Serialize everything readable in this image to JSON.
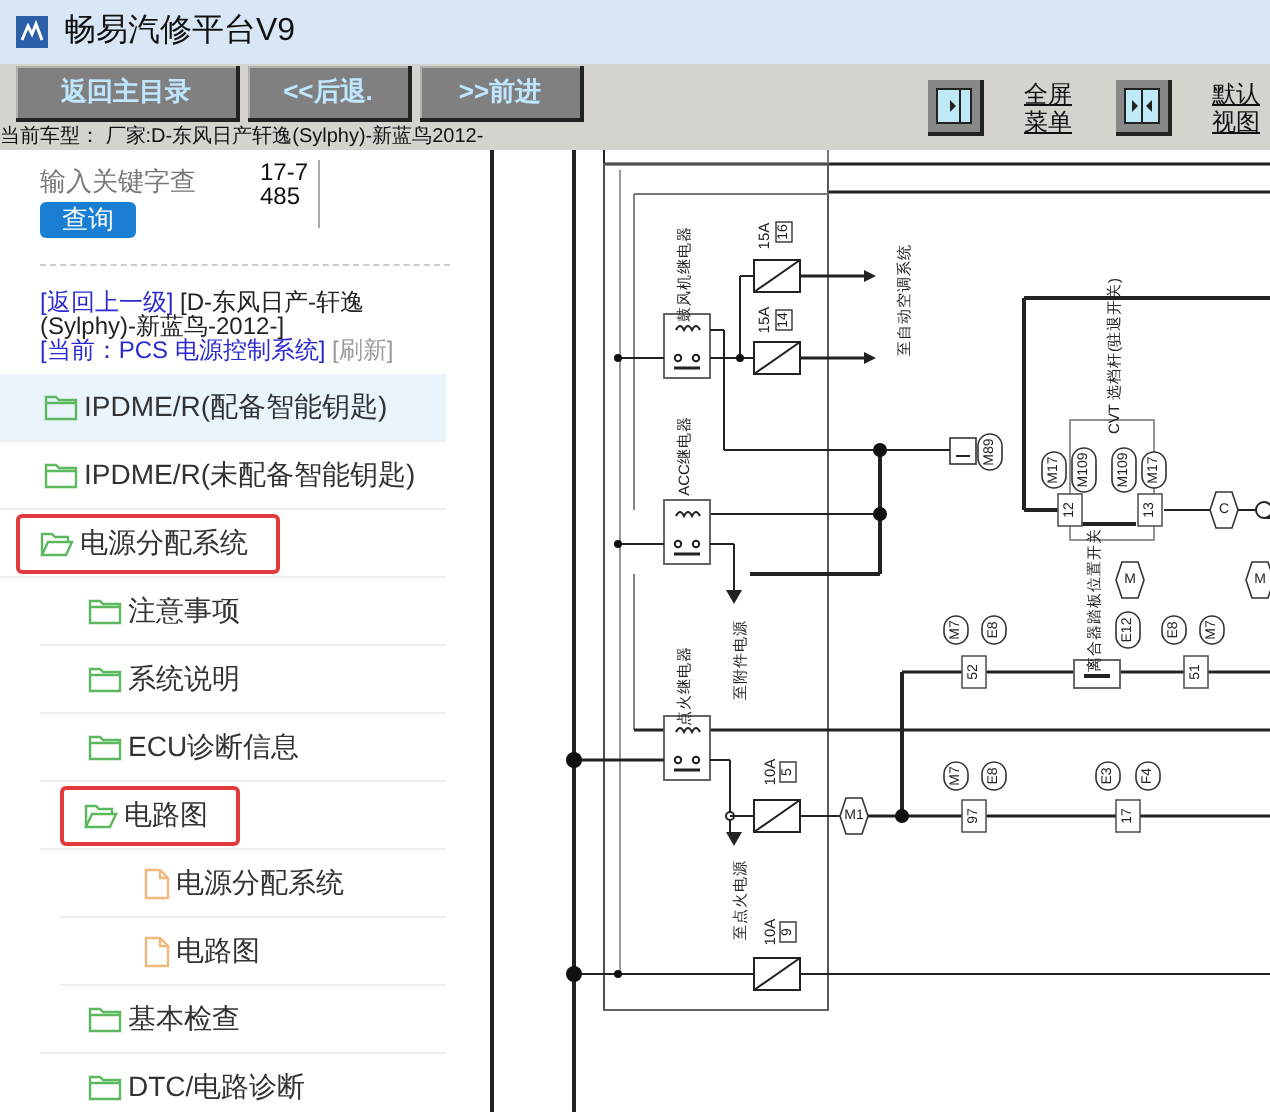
{
  "window": {
    "title": "畅易汽修平台V9"
  },
  "toolbar": {
    "buttons": [
      "返回主目录",
      "<<后退.",
      ">>前进"
    ],
    "view_links": [
      "全屏菜单",
      "默认视图"
    ]
  },
  "car_model": "当前车型： 厂家:D-东风日产轩逸(Sylphy)-新蓝鸟2012-",
  "search": {
    "placeholder": "输入关键字查",
    "code": "17-7485",
    "button": "查询"
  },
  "breadcrumb": {
    "back_link": "[返回上一级]",
    "path": "[D-东风日产-轩逸(Sylphy)-新蓝鸟-2012-]",
    "current": "[当前：PCS 电源控制系统]",
    "refresh": "[刷新]"
  },
  "tree": [
    {
      "label": "IPDME/R(配备智能钥匙)",
      "kind": "folder",
      "expanded": false,
      "selected": true,
      "outlined": false
    },
    {
      "label": "IPDME/R(未配备智能钥匙)",
      "kind": "folder",
      "expanded": false,
      "selected": false,
      "outlined": false
    },
    {
      "label": "电源分配系统",
      "kind": "folder",
      "expanded": true,
      "selected": false,
      "outlined": true,
      "children": [
        {
          "label": "注意事项",
          "kind": "folder",
          "expanded": false,
          "selected": false,
          "outlined": false
        },
        {
          "label": "系统说明",
          "kind": "folder",
          "expanded": false,
          "selected": false,
          "outlined": false
        },
        {
          "label": "ECU诊断信息",
          "kind": "folder",
          "expanded": false,
          "selected": false,
          "outlined": false
        },
        {
          "label": "电路图",
          "kind": "folder",
          "expanded": true,
          "selected": false,
          "outlined": true,
          "children": [
            {
              "label": "电源分配系统",
              "kind": "document",
              "selected": false,
              "outlined": false
            },
            {
              "label": "电路图",
              "kind": "document",
              "selected": false,
              "outlined": false
            }
          ]
        },
        {
          "label": "基本检查",
          "kind": "folder",
          "expanded": false,
          "selected": false,
          "outlined": false
        },
        {
          "label": "DTC/电路诊断",
          "kind": "folder",
          "expanded": false,
          "selected": false,
          "outlined": false
        }
      ]
    }
  ],
  "diagram_labels": [
    {
      "text": "15A",
      "kind": "text"
    },
    {
      "text": "16",
      "kind": "box"
    },
    {
      "text": "15A",
      "kind": "text"
    },
    {
      "text": "14",
      "kind": "box"
    },
    {
      "text": "鼓风机继电器",
      "kind": "text"
    },
    {
      "text": "至自动空调系统",
      "kind": "text"
    },
    {
      "text": "ACC继电器",
      "kind": "text"
    },
    {
      "text": "M89",
      "kind": "connector"
    },
    {
      "text": "CVT 选档杆(驻退开关)",
      "kind": "text"
    },
    {
      "text": "M17",
      "kind": "connector"
    },
    {
      "text": "M109",
      "kind": "connector"
    },
    {
      "text": "M109",
      "kind": "connector"
    },
    {
      "text": "M17",
      "kind": "connector"
    },
    {
      "text": "12",
      "kind": "pin"
    },
    {
      "text": "13",
      "kind": "pin"
    },
    {
      "text": "C",
      "kind": "hex"
    },
    {
      "text": "M",
      "kind": "hex"
    },
    {
      "text": "M",
      "kind": "hex"
    },
    {
      "text": "离合器踏板位置开关",
      "kind": "text"
    },
    {
      "text": "E12",
      "kind": "connector"
    },
    {
      "text": "M7",
      "kind": "connector"
    },
    {
      "text": "E8",
      "kind": "connector"
    },
    {
      "text": "E8",
      "kind": "connector"
    },
    {
      "text": "M7",
      "kind": "connector"
    },
    {
      "text": "52",
      "kind": "pin"
    },
    {
      "text": "51",
      "kind": "pin"
    },
    {
      "text": "点火继电器",
      "kind": "text"
    },
    {
      "text": "至附件电源",
      "kind": "text"
    },
    {
      "text": "10A",
      "kind": "text"
    },
    {
      "text": "5",
      "kind": "box"
    },
    {
      "text": "M1",
      "kind": "hex"
    },
    {
      "text": "M7",
      "kind": "connector"
    },
    {
      "text": "E8",
      "kind": "connector"
    },
    {
      "text": "E3",
      "kind": "connector"
    },
    {
      "text": "F4",
      "kind": "connector"
    },
    {
      "text": "97",
      "kind": "pin"
    },
    {
      "text": "17",
      "kind": "pin"
    },
    {
      "text": "至点火电源",
      "kind": "text"
    },
    {
      "text": "10A",
      "kind": "text"
    },
    {
      "text": "9",
      "kind": "box"
    }
  ]
}
